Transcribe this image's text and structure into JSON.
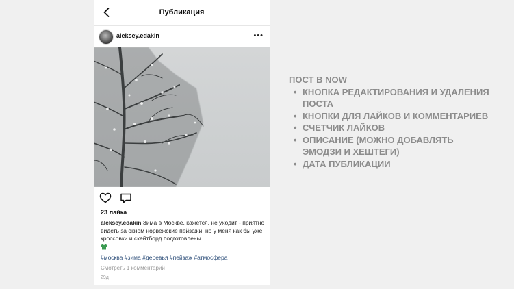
{
  "topbar": {
    "title": "Публикация"
  },
  "post": {
    "username": "aleksey.edakin",
    "likes": "23 лайка",
    "caption_text": "Зима в Москве, кажется, не уходит - приятно видеть за окном норвежские пейзажи, но у меня как бы уже кроссовки и скейтборд подготовлены",
    "hashtags": "#москва #зима #деревья #пейзаж #атмосфера",
    "view_comments": "Смотреть 1 комментарий",
    "date": "29д"
  },
  "info": {
    "title": "ПОСТ В NOW",
    "items": [
      "КНОПКА РЕДАКТИРОВАНИЯ И УДАЛЕНИЯ ПОСТА",
      "КНОПКИ ДЛЯ ЛАЙКОВ И КОММЕНТАРИЕВ",
      "СЧЕТЧИК ЛАЙКОВ",
      "ОПИСАНИЕ (МОЖНО ДОБАВЛЯТЬ ЭМОДЗИ И ХЕШТЕГИ)",
      "ДАТА ПУБЛИКАЦИИ"
    ]
  },
  "icons": {
    "back": "chevron-left-icon",
    "more": "more-horizontal-icon",
    "like": "heart-icon",
    "comment": "speech-bubble-icon",
    "emoji": "tshirt-emoji-icon"
  },
  "colors": {
    "background": "#f0f0f0",
    "hashtag": "#2e4f7a",
    "info_text": "#8c8c8c"
  }
}
